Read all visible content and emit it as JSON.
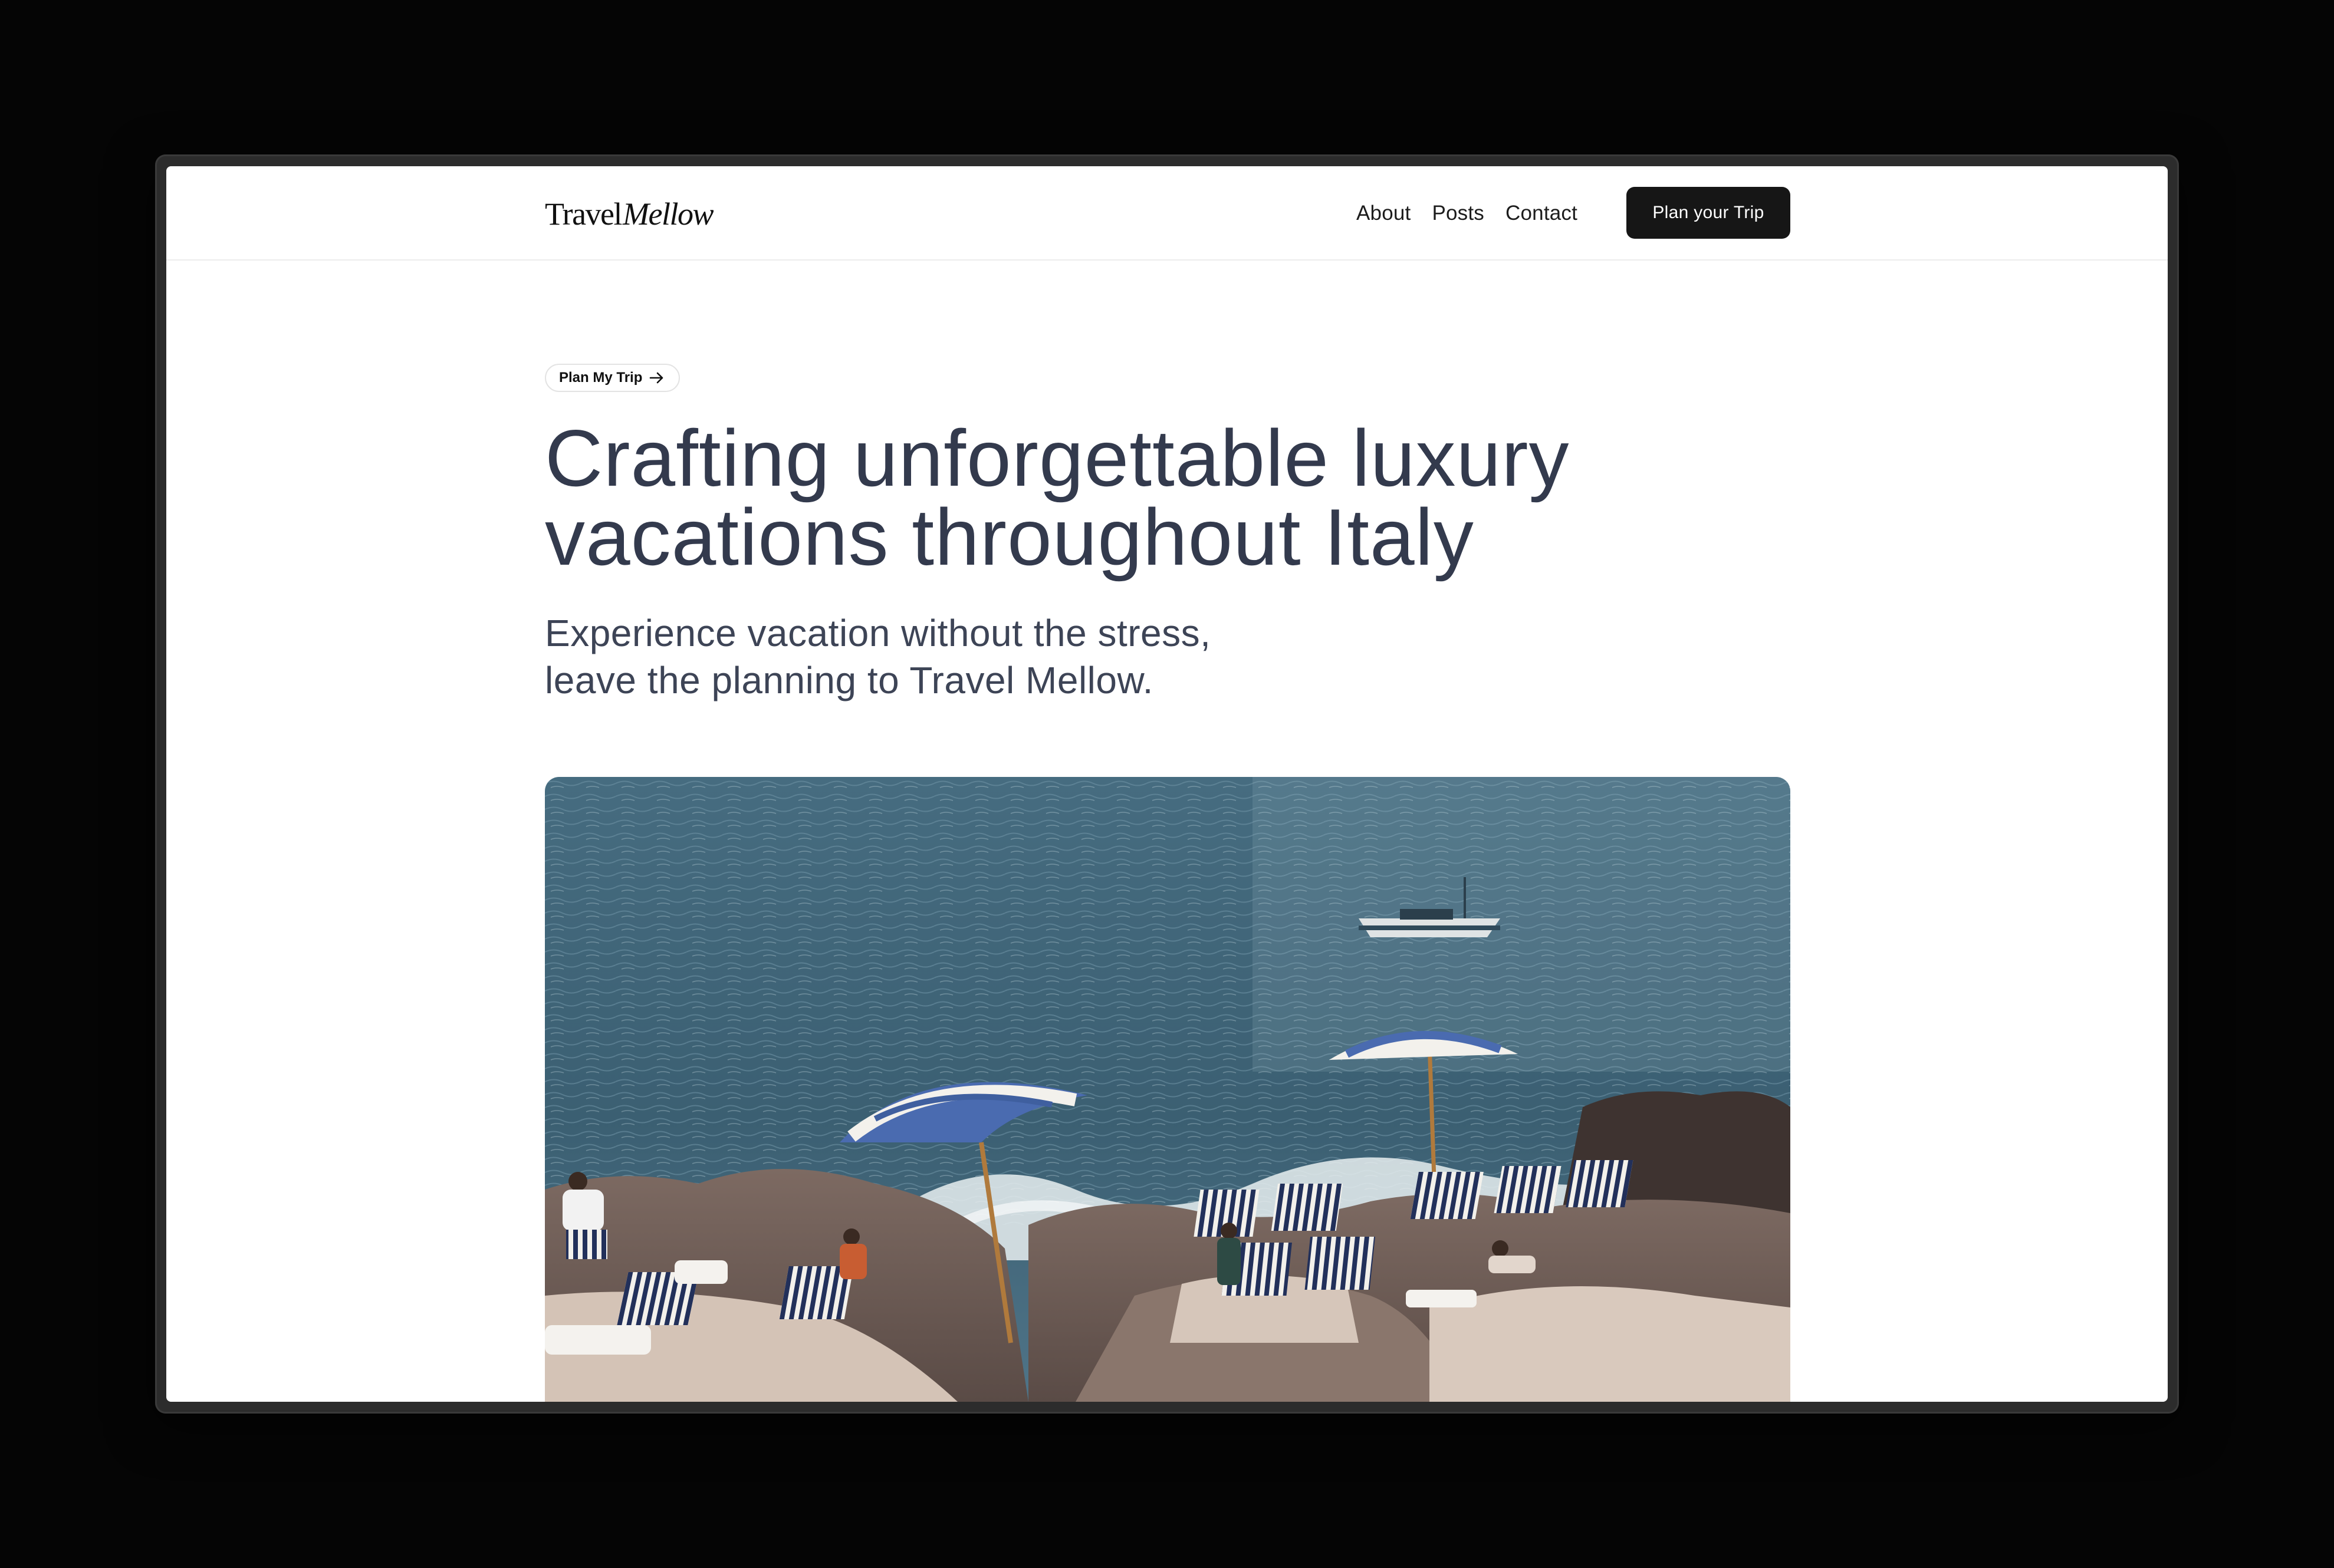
{
  "brand": {
    "logo_part1": "Travel",
    "logo_part2": "Mellow"
  },
  "nav": {
    "items": [
      {
        "label": "About"
      },
      {
        "label": "Posts"
      },
      {
        "label": "Contact"
      }
    ],
    "cta_label": "Plan your Trip"
  },
  "hero": {
    "pill_label": "Plan My Trip",
    "pill_icon": "arrow-right-icon",
    "headline_line1": "Crafting unforgettable luxury",
    "headline_line2": "vacations throughout Italy",
    "subhead_line1": "Experience vacation without the stress,",
    "subhead_line2": "leave the planning to Travel Mellow.",
    "image_alt": "Beach with striped umbrellas and deck chairs on a rocky coast"
  },
  "colors": {
    "headline": "#333a4d",
    "cta_bg": "#161616",
    "page_bg": "#ffffff",
    "sea": "#3f6478"
  }
}
